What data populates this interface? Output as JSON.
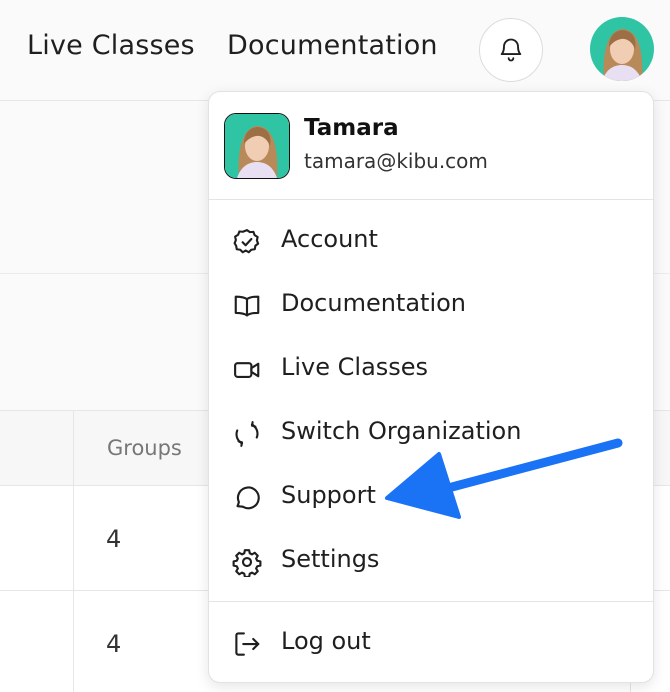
{
  "topnav": {
    "live_classes": "Live Classes",
    "documentation": "Documentation"
  },
  "table": {
    "groups_header": "Groups",
    "rows": [
      "4",
      "4"
    ]
  },
  "user": {
    "name": "Tamara",
    "email": "tamara@kibu.com"
  },
  "menu": {
    "items": [
      {
        "label": "Account",
        "icon": "badge-check-icon"
      },
      {
        "label": "Documentation",
        "icon": "book-open-icon"
      },
      {
        "label": "Live Classes",
        "icon": "video-camera-icon"
      },
      {
        "label": "Switch Organization",
        "icon": "refresh-icon"
      },
      {
        "label": "Support",
        "icon": "chat-bubble-icon"
      },
      {
        "label": "Settings",
        "icon": "gear-icon"
      }
    ],
    "logout": {
      "label": "Log out",
      "icon": "logout-icon"
    }
  },
  "colors": {
    "accent_arrow": "#1a73f5",
    "avatar_bg": "#2fc4a4"
  }
}
